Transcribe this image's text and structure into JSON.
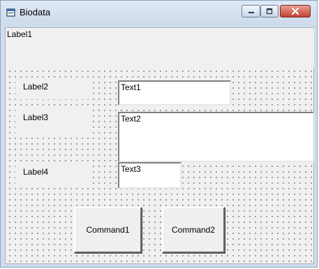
{
  "window": {
    "title": "Biodata"
  },
  "titlebar_buttons": {
    "minimize": "minimize-icon",
    "maximize": "maximize-icon",
    "close": "close-icon"
  },
  "form": {
    "label1": "Label1",
    "label2": "Label2",
    "label3": "Label3",
    "label4": "Label4",
    "text1": "Text1",
    "text2": "Text2",
    "text3": "Text3",
    "command1": "Command1",
    "command2": "Command2"
  },
  "colors": {
    "close_button": "#c54131",
    "form_background": "#f0f0f0"
  }
}
